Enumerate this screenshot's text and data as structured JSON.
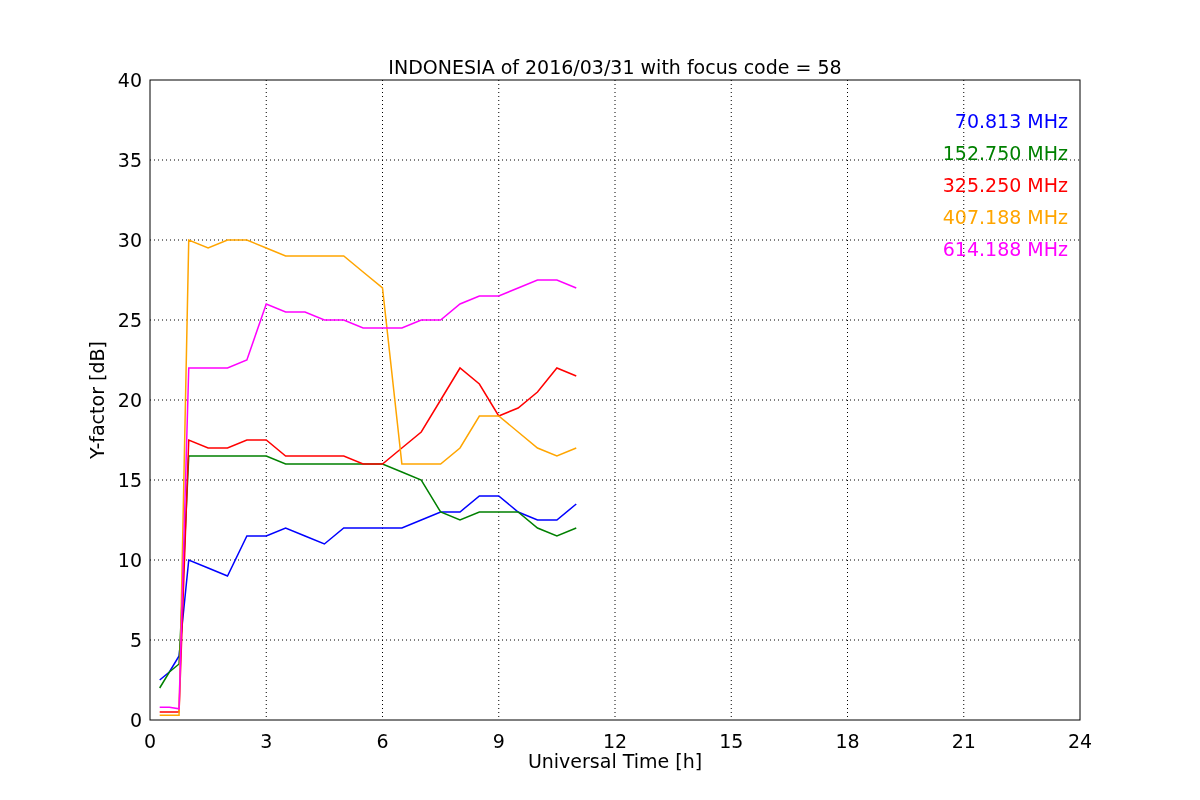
{
  "chart_data": {
    "type": "line",
    "title": "INDONESIA of 2016/03/31 with focus code = 58",
    "xlabel": "Universal Time [h]",
    "ylabel": "Y-factor [dB]",
    "x": [
      0.25,
      0.5,
      0.75,
      1,
      1.5,
      2,
      2.5,
      3,
      3.5,
      4,
      4.5,
      5,
      5.5,
      6,
      6.5,
      7,
      7.5,
      8,
      8.5,
      9,
      9.5,
      10,
      10.5,
      11
    ],
    "series": [
      {
        "name": "70.813 MHz",
        "color": "#0000ff",
        "values": [
          2.5,
          3,
          4,
          10,
          9.5,
          9,
          11.5,
          11.5,
          12,
          11.5,
          11,
          12,
          12,
          12,
          12,
          12.5,
          13,
          13,
          14,
          14,
          13,
          12.5,
          12.5,
          13.5
        ]
      },
      {
        "name": "152.750 MHz",
        "color": "#008000",
        "values": [
          2,
          3,
          3.5,
          16.5,
          16.5,
          16.5,
          16.5,
          16.5,
          16,
          16,
          16,
          16,
          16,
          16,
          15.5,
          15,
          13,
          12.5,
          13,
          13,
          13,
          12,
          11.5,
          12
        ]
      },
      {
        "name": "325.250 MHz",
        "color": "#ff0000",
        "values": [
          0.5,
          0.5,
          0.5,
          17.5,
          17,
          17,
          17.5,
          17.5,
          16.5,
          16.5,
          16.5,
          16.5,
          16,
          16,
          17,
          18,
          20,
          22,
          21,
          19,
          19.5,
          20.5,
          22,
          21.5
        ]
      },
      {
        "name": "407.188 MHz",
        "color": "#ffa500",
        "values": [
          0.3,
          0.3,
          0.3,
          30,
          29.5,
          30,
          30,
          29.5,
          29,
          29,
          29,
          29,
          28,
          27,
          16,
          16,
          16,
          17,
          19,
          19,
          18,
          17,
          16.5,
          17
        ]
      },
      {
        "name": "614.188 MHz",
        "color": "#ff00ff",
        "values": [
          0.8,
          0.8,
          0.7,
          22,
          22,
          22,
          22.5,
          26,
          25.5,
          25.5,
          25,
          25,
          24.5,
          24.5,
          24.5,
          25,
          25,
          26,
          26.5,
          26.5,
          27,
          27.5,
          27.5,
          27
        ]
      }
    ],
    "xlim": [
      0,
      24
    ],
    "ylim": [
      0,
      40
    ],
    "xticks": [
      0,
      3,
      6,
      9,
      12,
      15,
      18,
      21,
      24
    ],
    "yticks": [
      0,
      5,
      10,
      15,
      20,
      25,
      30,
      35,
      40
    ],
    "grid": true
  }
}
